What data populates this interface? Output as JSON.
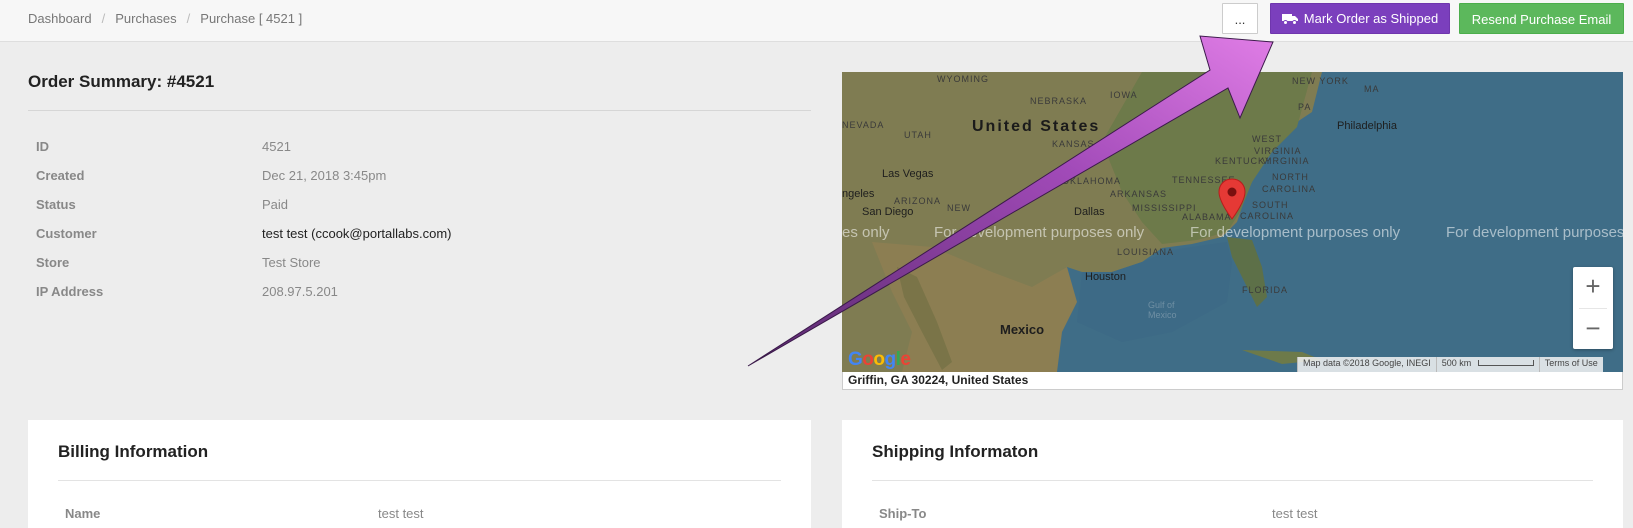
{
  "breadcrumb": {
    "items": [
      "Dashboard",
      "Purchases"
    ],
    "current": "Purchase [ 4521 ]"
  },
  "toolbar": {
    "more_label": "...",
    "ship_label": "Mark Order as Shipped",
    "email_label": "Resend Purchase Email",
    "ship_color": "#7b3fbd",
    "email_color": "#5cb85c"
  },
  "summary": {
    "title": "Order Summary: #4521",
    "rows": [
      {
        "label": "ID",
        "value": "4521"
      },
      {
        "label": "Created",
        "value": "Dec 21, 2018 3:45pm"
      },
      {
        "label": "Status",
        "value": "Paid"
      },
      {
        "label": "Customer",
        "value": "test test (ccook@portallabs.com)"
      },
      {
        "label": "Store",
        "value": "Test Store"
      },
      {
        "label": "IP Address",
        "value": "208.97.5.201"
      }
    ]
  },
  "map": {
    "country": "United States",
    "mexico": "Mexico",
    "states": [
      "WYOMING",
      "NEBRASKA",
      "IOWA",
      "UTAH",
      "KANSAS",
      "NEVADA",
      "ARIZONA",
      "NEW",
      "OKLAHOMA",
      "ARKANSAS",
      "MISSISSIPPI",
      "ALABAMA",
      "TENNESSEE",
      "KENTUCKY",
      "WEST",
      "VIRGINIA",
      "VIRGINIA",
      "NORTH",
      "CAROLINA",
      "SOUTH",
      "CAROLINA",
      "LOUISIANA",
      "FLORIDA",
      "NEW YORK",
      "MA",
      "PA"
    ],
    "cities": [
      "Las Vegas",
      "San Diego",
      "Dallas",
      "Houston",
      "Philadelphia",
      "ngeles"
    ],
    "gulf": "Gulf of\nMexico",
    "watermarks": [
      "es only",
      "For development purposes only",
      "For development purposes only",
      "For development purposes"
    ],
    "logo": "Google",
    "attribution": "Map data ©2018 Google, INEGI",
    "scale": "500 km",
    "terms": "Terms of Use",
    "zoom_in": "+",
    "zoom_out": "−",
    "address": "Griffin, GA 30224, United States",
    "pin_color": "#e53935"
  },
  "billing": {
    "title": "Billing Information",
    "name_label": "Name",
    "name_value": "test test"
  },
  "shipping": {
    "title": "Shipping Informaton",
    "shipto_label": "Ship-To",
    "shipto_value": "test test"
  },
  "icons": {
    "truck": "truck-icon",
    "pin": "map-pin-icon",
    "arrow": "annotation-arrow"
  }
}
